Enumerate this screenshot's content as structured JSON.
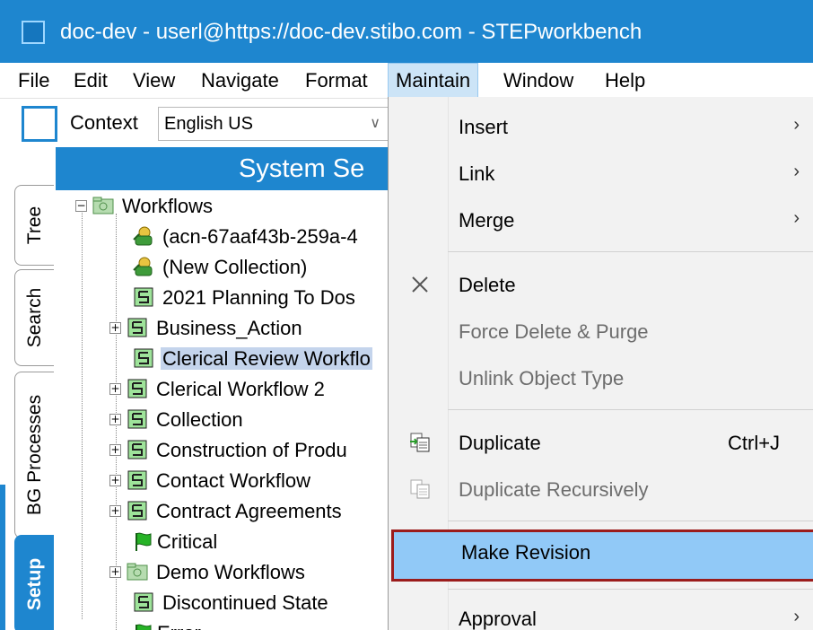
{
  "window": {
    "title": "doc-dev - userl@https://doc-dev.stibo.com - STEPworkbench"
  },
  "menubar": {
    "items": [
      "File",
      "Edit",
      "View",
      "Navigate",
      "Format",
      "Maintain",
      "Window",
      "Help"
    ],
    "active": "Maintain"
  },
  "context": {
    "label": "Context",
    "value": "English US"
  },
  "sidetabs": {
    "tabs": [
      "Tree",
      "Search",
      "BG Processes",
      "Setup"
    ],
    "selected": "Setup"
  },
  "panel": {
    "header": "System Se"
  },
  "tree": {
    "root": "Workflows",
    "items": [
      {
        "label": "(acn-67aaf43b-259a-4",
        "icon": "collection-icon",
        "expandable": false
      },
      {
        "label": "(New Collection)",
        "icon": "collection-icon",
        "expandable": false
      },
      {
        "label": "2021 Planning To Dos",
        "icon": "workflow-icon",
        "expandable": false
      },
      {
        "label": "Business_Action",
        "icon": "workflow-icon",
        "expandable": true
      },
      {
        "label": "Clerical Review Workflo",
        "icon": "workflow-icon",
        "expandable": false,
        "selected": true
      },
      {
        "label": "Clerical Workflow 2",
        "icon": "workflow-icon",
        "expandable": true
      },
      {
        "label": "Collection",
        "icon": "workflow-icon",
        "expandable": true
      },
      {
        "label": "Construction of Produ",
        "icon": "workflow-icon",
        "expandable": true
      },
      {
        "label": "Contact Workflow",
        "icon": "workflow-icon",
        "expandable": true
      },
      {
        "label": "Contract Agreements",
        "icon": "workflow-icon",
        "expandable": true
      },
      {
        "label": "Critical",
        "icon": "state-flag-icon",
        "expandable": false
      },
      {
        "label": "Demo Workflows",
        "icon": "folder-icon",
        "expandable": true
      },
      {
        "label": "Discontinued State",
        "icon": "workflow-icon",
        "expandable": false
      },
      {
        "label": "Error",
        "icon": "state-flag-icon",
        "expandable": false
      }
    ]
  },
  "maintain_menu": {
    "items": [
      {
        "label": "Insert",
        "submenu": true
      },
      {
        "label": "Link",
        "submenu": true
      },
      {
        "label": "Merge",
        "submenu": true
      },
      {
        "label": "Delete",
        "icon": "close-icon"
      },
      {
        "label": "Force Delete & Purge",
        "disabled": true
      },
      {
        "label": "Unlink Object Type",
        "disabled": true
      },
      {
        "label": "Duplicate",
        "icon": "duplicate-icon",
        "shortcut": "Ctrl+J"
      },
      {
        "label": "Duplicate Recursively",
        "icon": "duplicate-recursive-icon",
        "disabled": true
      },
      {
        "label": "Make Revision",
        "highlighted": true
      },
      {
        "label": "Approval",
        "submenu": true
      }
    ],
    "submenu_arrow": "›",
    "highlight_border_color": "#9b1c1c",
    "highlight_fill_color": "#91c9f7"
  },
  "colors": {
    "accent": "#1e86cf"
  }
}
